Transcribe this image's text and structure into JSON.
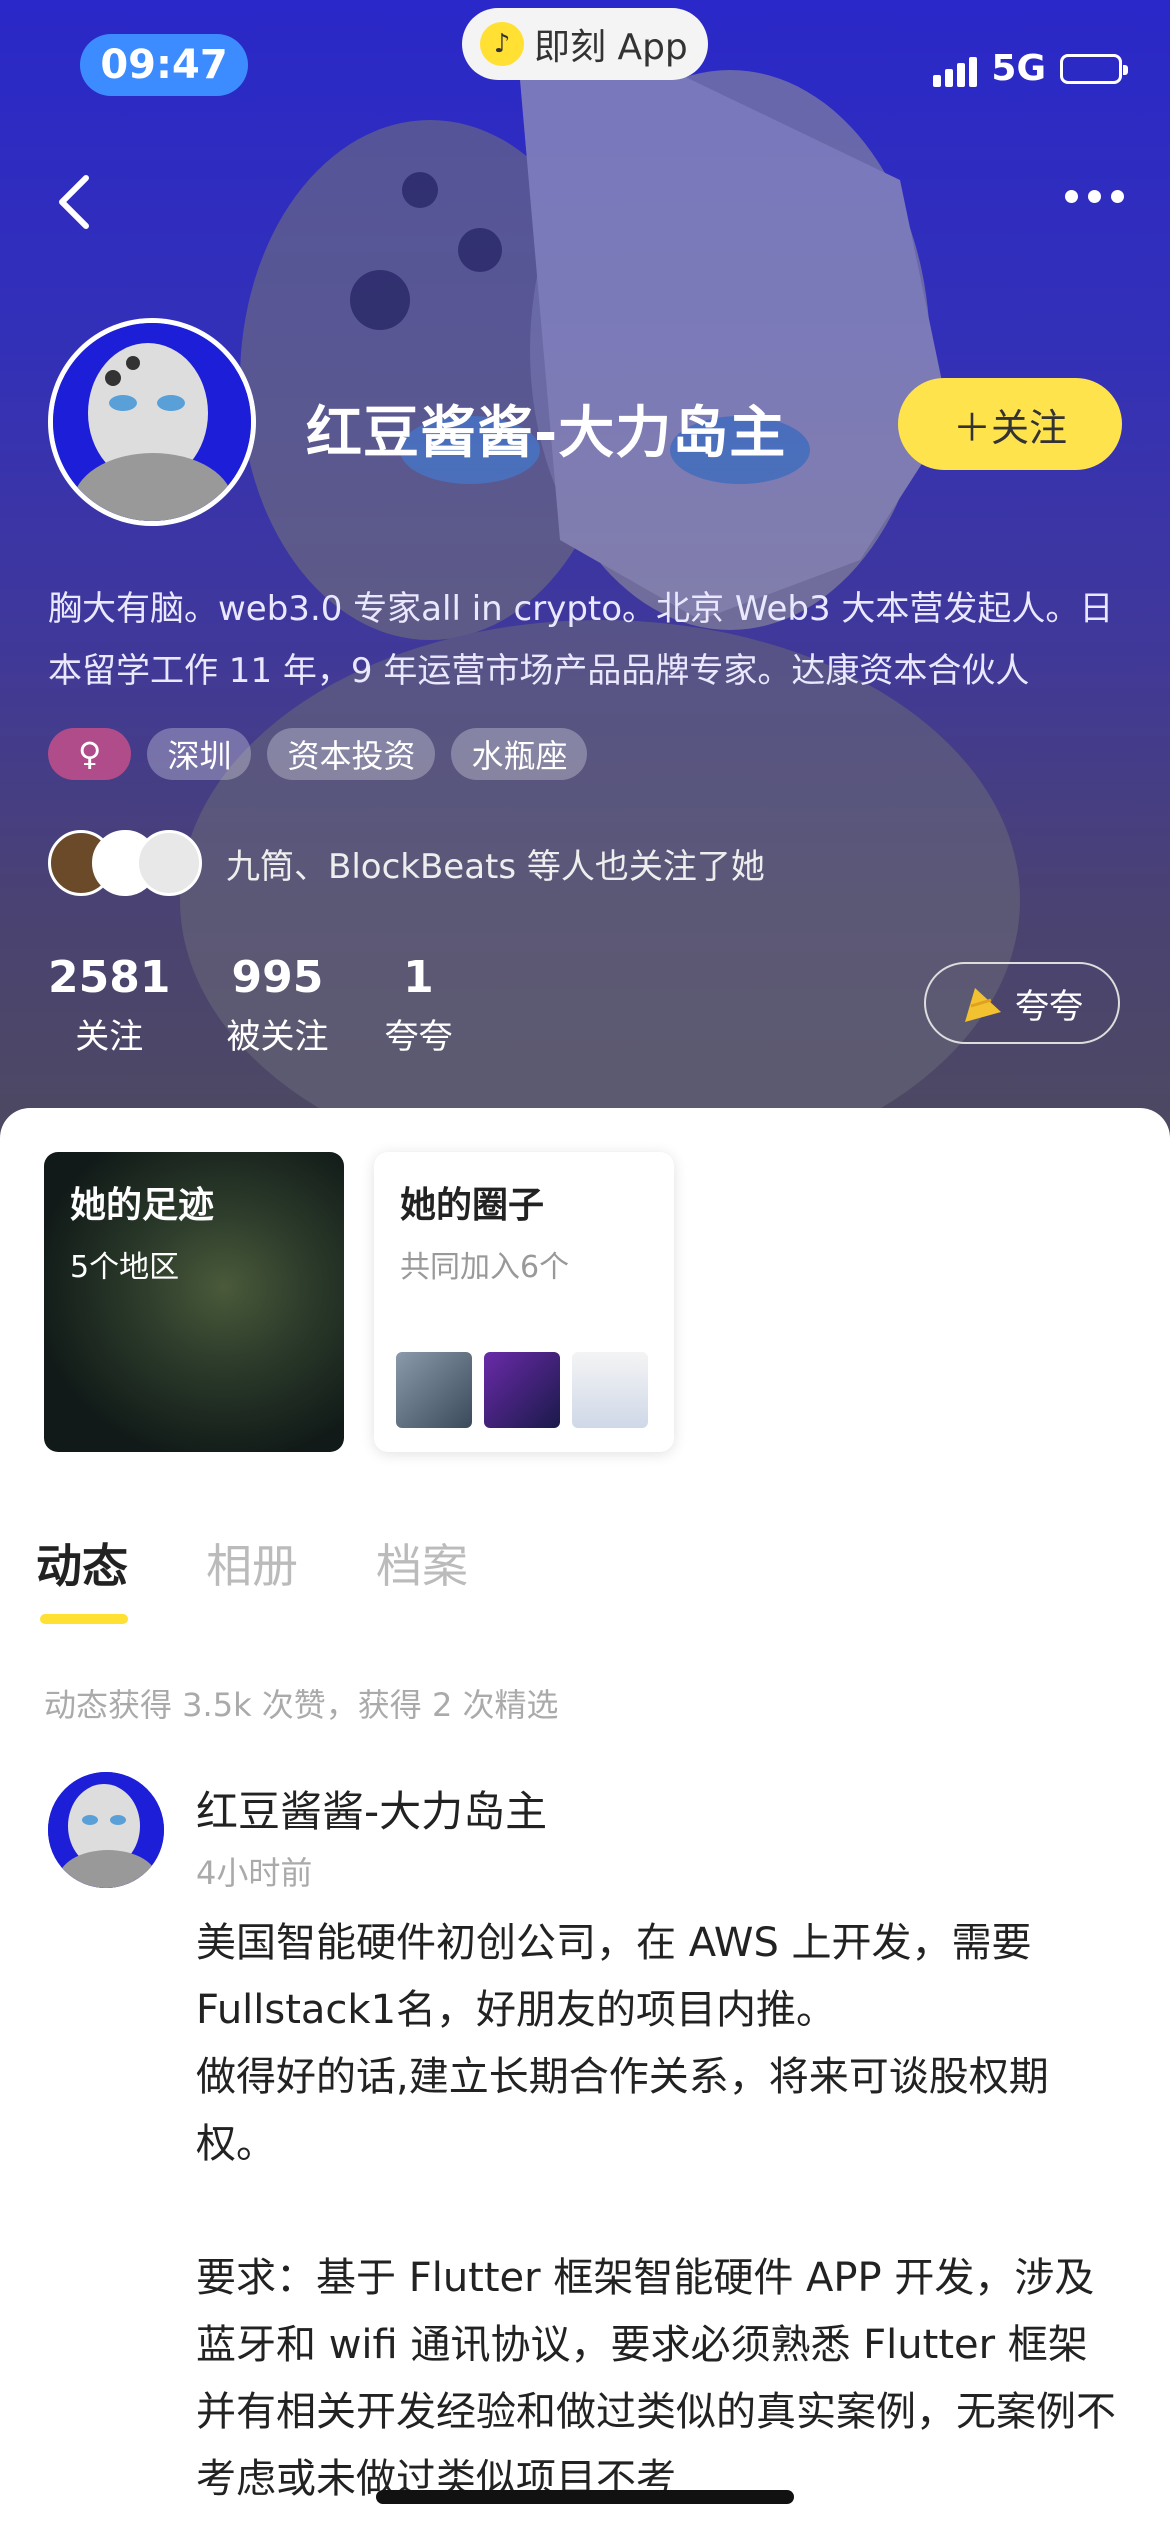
{
  "status_bar": {
    "time": "09:47",
    "app_name": "即刻 App",
    "network": "5G"
  },
  "profile": {
    "nickname": "红豆酱酱-大力岛主",
    "follow_label": "＋关注",
    "bio": "胸大有脑。web3.0 专家all in crypto。北京 Web3 大本营发起人。日本留学工作 11 年，9 年运营市场产品品牌专家。达康资本合伙人",
    "tags": {
      "gender": "♀",
      "city": "深圳",
      "industry": "资本投资",
      "zodiac": "水瓶座"
    },
    "mutual_followers": "九筒、BlockBeats 等人也关注了她",
    "stats": [
      {
        "num": "2581",
        "label": "关注"
      },
      {
        "num": "995",
        "label": "被关注"
      },
      {
        "num": "1",
        "label": "夸夸"
      }
    ],
    "praise_label": "夸夸"
  },
  "cards": {
    "footprint": {
      "title": "她的足迹",
      "sub": "5个地区"
    },
    "circles": {
      "title": "她的圈子",
      "sub": "共同加入6个"
    }
  },
  "tabs": [
    "动态",
    "相册",
    "档案"
  ],
  "summary": "动态获得 3.5k 次赞，获得 2 次精选",
  "post": {
    "author": "红豆酱酱-大力岛主",
    "time": "4小时前",
    "text": "美国智能硬件初创公司，在 AWS 上开发，需要 Fullstack1名，好朋友的项目内推。\n做得好的话,建立长期合作关系，将来可谈股权期权。\n\n要求：基于 Flutter 框架智能硬件 APP 开发，涉及蓝牙和 wifi 通讯协议，要求必须熟悉 Flutter 框架并有相关开发经验和做过类似的真实案例，无案例不考虑或未做过类似项目不考"
  },
  "colors": {
    "accent_yellow": "#ffe34d",
    "header_blue": "#2a28c8",
    "gender_tag": "#b04c8a"
  }
}
